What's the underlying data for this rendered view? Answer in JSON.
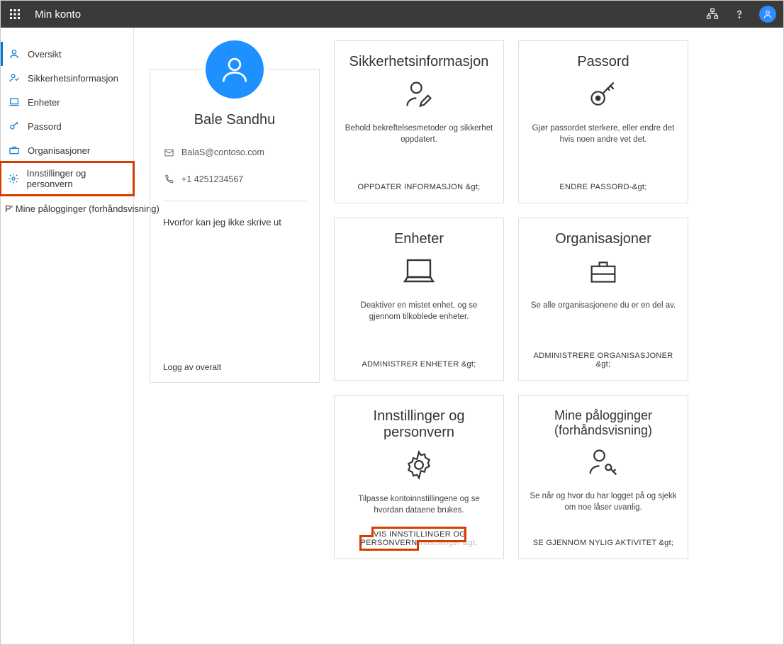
{
  "header": {
    "title": "Min konto"
  },
  "sidebar": {
    "items": [
      {
        "label": "Oversikt"
      },
      {
        "label": "Sikkerhetsinformasjon"
      },
      {
        "label": "Enheter"
      },
      {
        "label": "Passord"
      },
      {
        "label": "Organisasjoner"
      },
      {
        "label": "Innstillinger og personvern"
      }
    ],
    "extra_prefix": "P'",
    "extra_label": "Mine pålogginger (forhåndsvisning)"
  },
  "profile": {
    "name": "Bale  Sandhu",
    "email": "BalaS@contoso.com",
    "phone": "+1 4251234567",
    "why_text": "Hvorfor kan jeg ikke skrive ut",
    "logout": "Logg av overalt"
  },
  "cards": {
    "security": {
      "title": "Sikkerhetsinformasjon",
      "desc": "Behold bekreftelsesmetoder og sikkerhet oppdatert.",
      "action": "OPPDATER INFORMASJON &gt;"
    },
    "password": {
      "title": "Passord",
      "desc": "Gjør passordet sterkere, eller endre det hvis noen andre vet det.",
      "action": "ENDRE PASSORD-&gt;"
    },
    "devices": {
      "title": "Enheter",
      "desc": "Deaktiver en mistet enhet, og se gjennom tilkoblede enheter.",
      "action": "ADMINISTRER ENHETER &gt;"
    },
    "orgs": {
      "title": "Organisasjoner",
      "desc": "Se alle organisasjonene du er en del av.",
      "action": "ADMINISTRERE ORGANISASJONER &gt;"
    },
    "settings": {
      "title": "Innstillinger og personvern",
      "desc": "Tilpasse kontoinnstillingene og se hvordan dataene brukes.",
      "action_main": "VIS INNSTILLINGER OG PERSONVERN",
      "action_suffix": "innstillinger &gt;"
    },
    "signins": {
      "title": "Mine pålogginger (forhåndsvisning)",
      "desc": "Se når og hvor du har logget på og sjekk om noe låser uvanlig.",
      "action": "SE GJENNOM NYLIG AKTIVITET &gt;"
    }
  }
}
